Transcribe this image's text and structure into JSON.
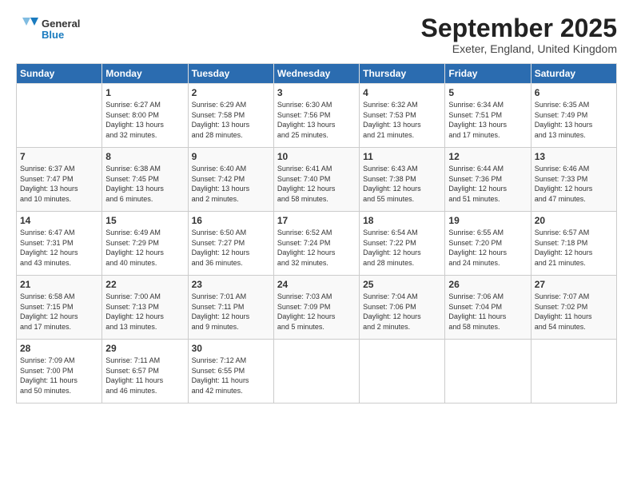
{
  "logo": {
    "general": "General",
    "blue": "Blue"
  },
  "title": "September 2025",
  "subtitle": "Exeter, England, United Kingdom",
  "weekdays": [
    "Sunday",
    "Monday",
    "Tuesday",
    "Wednesday",
    "Thursday",
    "Friday",
    "Saturday"
  ],
  "weeks": [
    [
      {
        "num": "",
        "info": ""
      },
      {
        "num": "1",
        "info": "Sunrise: 6:27 AM\nSunset: 8:00 PM\nDaylight: 13 hours\nand 32 minutes."
      },
      {
        "num": "2",
        "info": "Sunrise: 6:29 AM\nSunset: 7:58 PM\nDaylight: 13 hours\nand 28 minutes."
      },
      {
        "num": "3",
        "info": "Sunrise: 6:30 AM\nSunset: 7:56 PM\nDaylight: 13 hours\nand 25 minutes."
      },
      {
        "num": "4",
        "info": "Sunrise: 6:32 AM\nSunset: 7:53 PM\nDaylight: 13 hours\nand 21 minutes."
      },
      {
        "num": "5",
        "info": "Sunrise: 6:34 AM\nSunset: 7:51 PM\nDaylight: 13 hours\nand 17 minutes."
      },
      {
        "num": "6",
        "info": "Sunrise: 6:35 AM\nSunset: 7:49 PM\nDaylight: 13 hours\nand 13 minutes."
      }
    ],
    [
      {
        "num": "7",
        "info": "Sunrise: 6:37 AM\nSunset: 7:47 PM\nDaylight: 13 hours\nand 10 minutes."
      },
      {
        "num": "8",
        "info": "Sunrise: 6:38 AM\nSunset: 7:45 PM\nDaylight: 13 hours\nand 6 minutes."
      },
      {
        "num": "9",
        "info": "Sunrise: 6:40 AM\nSunset: 7:42 PM\nDaylight: 13 hours\nand 2 minutes."
      },
      {
        "num": "10",
        "info": "Sunrise: 6:41 AM\nSunset: 7:40 PM\nDaylight: 12 hours\nand 58 minutes."
      },
      {
        "num": "11",
        "info": "Sunrise: 6:43 AM\nSunset: 7:38 PM\nDaylight: 12 hours\nand 55 minutes."
      },
      {
        "num": "12",
        "info": "Sunrise: 6:44 AM\nSunset: 7:36 PM\nDaylight: 12 hours\nand 51 minutes."
      },
      {
        "num": "13",
        "info": "Sunrise: 6:46 AM\nSunset: 7:33 PM\nDaylight: 12 hours\nand 47 minutes."
      }
    ],
    [
      {
        "num": "14",
        "info": "Sunrise: 6:47 AM\nSunset: 7:31 PM\nDaylight: 12 hours\nand 43 minutes."
      },
      {
        "num": "15",
        "info": "Sunrise: 6:49 AM\nSunset: 7:29 PM\nDaylight: 12 hours\nand 40 minutes."
      },
      {
        "num": "16",
        "info": "Sunrise: 6:50 AM\nSunset: 7:27 PM\nDaylight: 12 hours\nand 36 minutes."
      },
      {
        "num": "17",
        "info": "Sunrise: 6:52 AM\nSunset: 7:24 PM\nDaylight: 12 hours\nand 32 minutes."
      },
      {
        "num": "18",
        "info": "Sunrise: 6:54 AM\nSunset: 7:22 PM\nDaylight: 12 hours\nand 28 minutes."
      },
      {
        "num": "19",
        "info": "Sunrise: 6:55 AM\nSunset: 7:20 PM\nDaylight: 12 hours\nand 24 minutes."
      },
      {
        "num": "20",
        "info": "Sunrise: 6:57 AM\nSunset: 7:18 PM\nDaylight: 12 hours\nand 21 minutes."
      }
    ],
    [
      {
        "num": "21",
        "info": "Sunrise: 6:58 AM\nSunset: 7:15 PM\nDaylight: 12 hours\nand 17 minutes."
      },
      {
        "num": "22",
        "info": "Sunrise: 7:00 AM\nSunset: 7:13 PM\nDaylight: 12 hours\nand 13 minutes."
      },
      {
        "num": "23",
        "info": "Sunrise: 7:01 AM\nSunset: 7:11 PM\nDaylight: 12 hours\nand 9 minutes."
      },
      {
        "num": "24",
        "info": "Sunrise: 7:03 AM\nSunset: 7:09 PM\nDaylight: 12 hours\nand 5 minutes."
      },
      {
        "num": "25",
        "info": "Sunrise: 7:04 AM\nSunset: 7:06 PM\nDaylight: 12 hours\nand 2 minutes."
      },
      {
        "num": "26",
        "info": "Sunrise: 7:06 AM\nSunset: 7:04 PM\nDaylight: 11 hours\nand 58 minutes."
      },
      {
        "num": "27",
        "info": "Sunrise: 7:07 AM\nSunset: 7:02 PM\nDaylight: 11 hours\nand 54 minutes."
      }
    ],
    [
      {
        "num": "28",
        "info": "Sunrise: 7:09 AM\nSunset: 7:00 PM\nDaylight: 11 hours\nand 50 minutes."
      },
      {
        "num": "29",
        "info": "Sunrise: 7:11 AM\nSunset: 6:57 PM\nDaylight: 11 hours\nand 46 minutes."
      },
      {
        "num": "30",
        "info": "Sunrise: 7:12 AM\nSunset: 6:55 PM\nDaylight: 11 hours\nand 42 minutes."
      },
      {
        "num": "",
        "info": ""
      },
      {
        "num": "",
        "info": ""
      },
      {
        "num": "",
        "info": ""
      },
      {
        "num": "",
        "info": ""
      }
    ]
  ]
}
